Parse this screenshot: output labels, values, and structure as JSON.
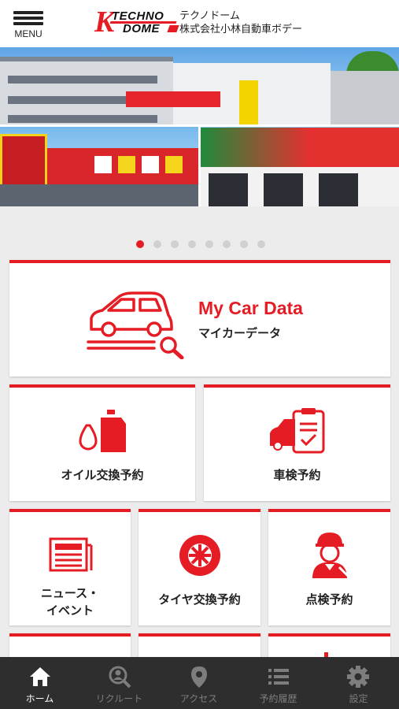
{
  "header": {
    "menu_label": "MENU",
    "logo_text_1": "TECHNO",
    "logo_text_2": "DOME",
    "company_line_1": "テクノドーム",
    "company_line_2": "株式会社小林自動車ボデー"
  },
  "carousel": {
    "slide_count": 8,
    "active_index": 0
  },
  "tiles": {
    "my_car": {
      "title": "My Car Data",
      "subtitle": "マイカーデータ"
    },
    "oil": {
      "label": "オイル交換予約"
    },
    "shaken": {
      "label": "車検予約"
    },
    "news": {
      "label_1": "ニュース・",
      "label_2": "イベント"
    },
    "tire": {
      "label": "タイヤ交換予約"
    },
    "inspection": {
      "label": "点検予約"
    }
  },
  "tabbar": {
    "items": [
      {
        "label": "ホーム",
        "icon": "home-icon",
        "active": true
      },
      {
        "label": "リクルート",
        "icon": "recruit-search-icon",
        "active": false
      },
      {
        "label": "アクセス",
        "icon": "map-pin-icon",
        "active": false
      },
      {
        "label": "予約履歴",
        "icon": "list-icon",
        "active": false
      },
      {
        "label": "設定",
        "icon": "gear-icon",
        "active": false
      }
    ]
  },
  "colors": {
    "accent": "#e51c23",
    "tabbar_bg": "#2e2e2e",
    "tab_inactive": "#7d7d7d"
  }
}
